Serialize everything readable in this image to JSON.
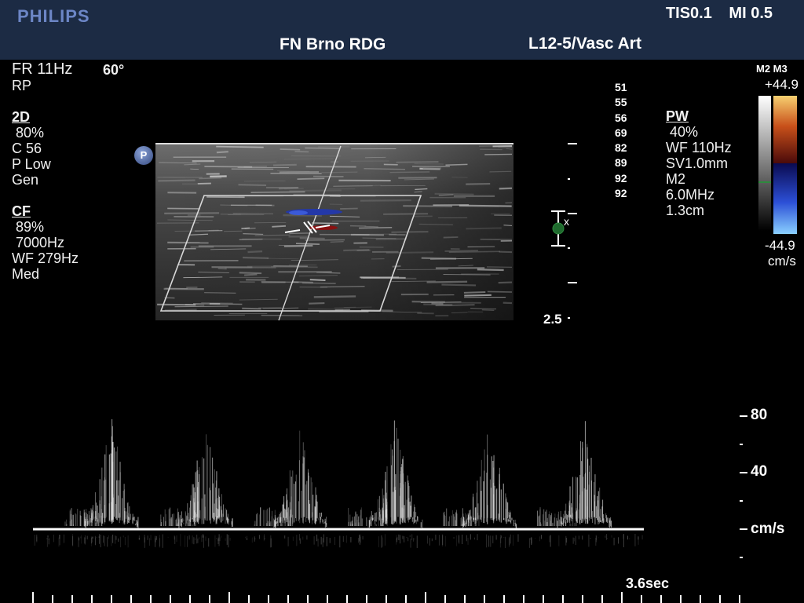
{
  "header": {
    "brand": "PHILIPS",
    "tis": "TIS0.1",
    "mi": "MI 0.5",
    "site": "FN Brno RDG",
    "probe_preset": "L12-5/Vasc Art"
  },
  "left_panel": {
    "frame_rate": "FR 11Hz",
    "angle": "60°",
    "orientation": "RP",
    "twod": {
      "title": "2D",
      "gain": "80%",
      "compression": "C 56",
      "persistence": "P Low",
      "mode": "Gen"
    },
    "cf": {
      "title": "CF",
      "gain": "89%",
      "prf": "7000Hz",
      "wall_filter": "WF 279Hz",
      "setting": "Med"
    }
  },
  "image_marker": "P",
  "depth_values": [
    "51",
    "55",
    "56",
    "69",
    "82",
    "89",
    "92",
    "92"
  ],
  "pw_panel": {
    "title": "PW",
    "gain": "40%",
    "wall_filter": "WF 110Hz",
    "sample_volume": "SV1.0mm",
    "mode": "M2",
    "frequency": "6.0MHz",
    "depth": "1.3cm"
  },
  "colorbar": {
    "maps": "M2 M3",
    "max": "+44.9",
    "min": "-44.9",
    "unit": "cm/s",
    "colors": {
      "positive": "#d47a1a",
      "negative": "#3b6de0"
    }
  },
  "depth_scale_label": "2.5",
  "focus_marker_label": "x",
  "spectral": {
    "velocity_labels": [
      "80",
      "40",
      "cm/s"
    ],
    "sweep_time": "3.6sec",
    "peak_velocity": 80,
    "cycles": 6
  }
}
